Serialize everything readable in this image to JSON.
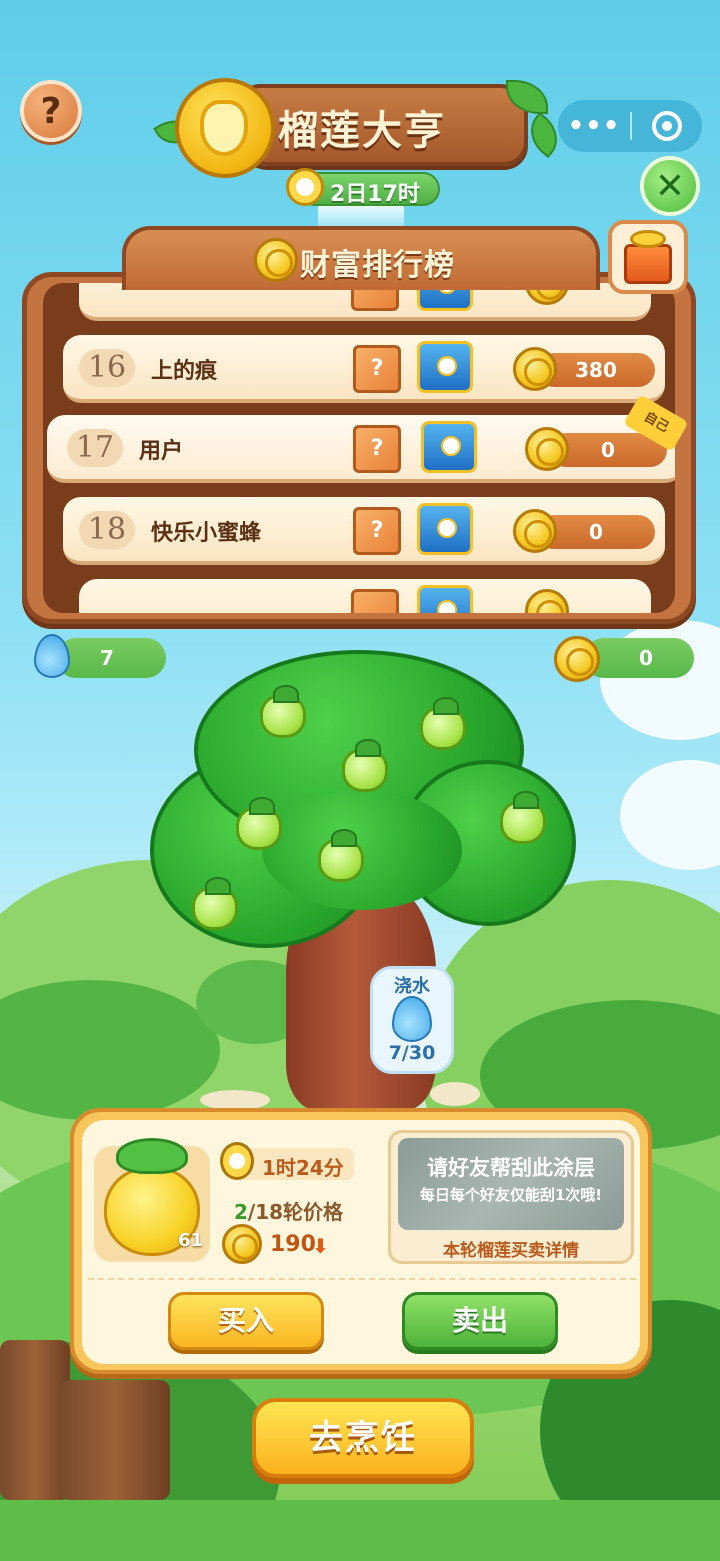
{
  "header": {
    "game_title": "榴莲大亨",
    "countdown": "2日17时",
    "help_label": "?",
    "capsule_more": "•••"
  },
  "leaderboard": {
    "title": "财富排行榜",
    "rows": [
      {
        "rank": "16",
        "name": "上的痕",
        "score": "380"
      },
      {
        "rank": "17",
        "name": "用户",
        "score": "0",
        "self": true
      },
      {
        "rank": "18",
        "name": "快乐小蜜蜂",
        "score": "0"
      }
    ],
    "self_tag": "自己",
    "cube_mark": "?"
  },
  "resources": {
    "water": "7",
    "coins": "0"
  },
  "watering": {
    "label": "浇水",
    "progress": "7/30"
  },
  "trade_panel": {
    "durian_count": "61",
    "time_left": "1时24分",
    "round_current": "2",
    "round_text": "/18轮价格",
    "price": "190",
    "scratch_title": "请好友帮刮此涂层",
    "scratch_sub": "每日每个好友仅能刮1次哦!",
    "details_link": "本轮榴莲买卖详情",
    "buy_label": "买入",
    "sell_label": "卖出"
  },
  "cook_button": "去烹饪",
  "icons": [
    "help-icon",
    "durian-icon",
    "clock-icon",
    "more-icon",
    "target-icon",
    "close-icon",
    "gift-icon",
    "coin-icon",
    "mystery-cube-icon",
    "treasure-chest-icon",
    "water-drop-icon",
    "fruit-icon",
    "price-down-icon"
  ]
}
